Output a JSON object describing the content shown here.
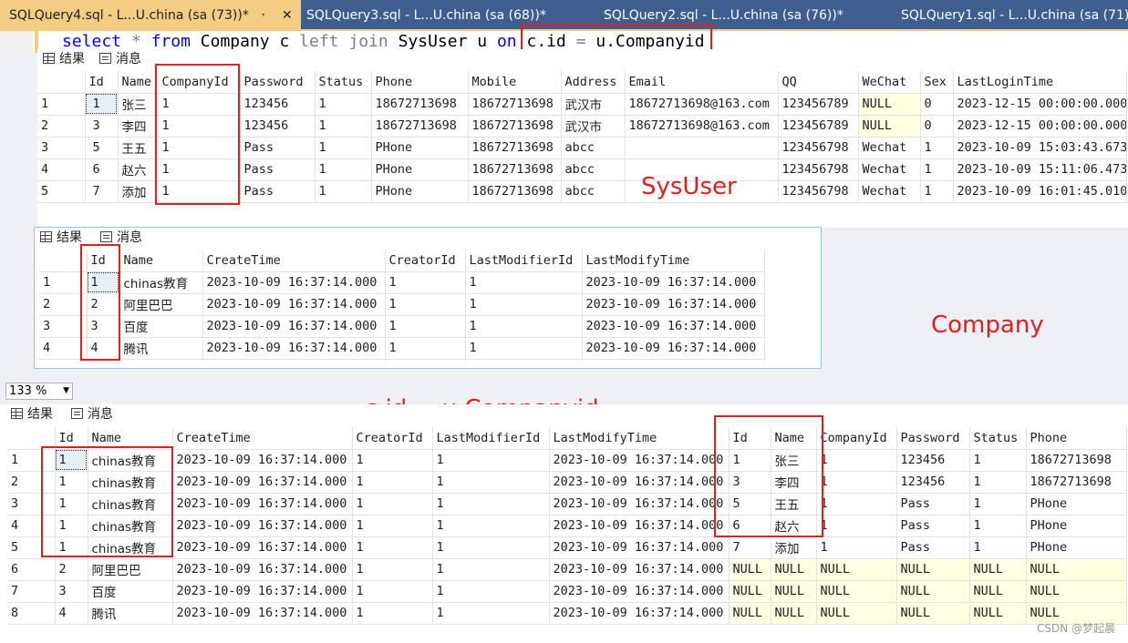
{
  "tabs": [
    {
      "label": "SQLQuery4.sql - L...U.china (sa (73))*",
      "active": true
    },
    {
      "label": "SQLQuery3.sql - L...U.china (sa (68))*",
      "active": false
    },
    {
      "label": "SQLQuery2.sql - L...U.china (sa (76))*",
      "active": false
    },
    {
      "label": "SQLQuery1.sql - L...U.china (sa (71))",
      "active": false
    }
  ],
  "editor": {
    "kw_select": "select",
    "star": "*",
    "kw_from": "from",
    "table1": "Company",
    "alias1": "c",
    "kw_left": "left",
    "kw_join": "join",
    "table2": "SysUser",
    "alias2": "u",
    "kw_on": "on",
    "lhs": "c.id",
    "eq": "=",
    "rhs": "u.Companyid"
  },
  "result_tab_label": "结果",
  "messages_tab_label": "消息",
  "zoom": "133 %",
  "annotations": {
    "sysuser": "SysUser",
    "company": "Company",
    "join_cond": "c.id = u.Companyid"
  },
  "watermark": "CSDN @梦起晨",
  "grid1": {
    "columns": [
      "",
      "Id",
      "Name",
      "CompanyId",
      "Password",
      "Status",
      "Phone",
      "Mobile",
      "Address",
      "Email",
      "QQ",
      "WeChat",
      "Sex",
      "LastLoginTime"
    ],
    "rows": [
      [
        "1",
        "1",
        "张三",
        "1",
        "123456",
        "1",
        "18672713698",
        "18672713698",
        "武汉市",
        "18672713698@163.com",
        "123456789",
        "NULL",
        "0",
        "2023-12-15 00:00:00.000"
      ],
      [
        "2",
        "3",
        "李四",
        "1",
        "123456",
        "1",
        "18672713698",
        "18672713698",
        "武汉市",
        "18672713698@163.com",
        "123456789",
        "NULL",
        "0",
        "2023-12-15 00:00:00.000"
      ],
      [
        "3",
        "5",
        "王五",
        "1",
        "Pass",
        "1",
        "PHone",
        "18672713698",
        "abcc",
        "",
        "123456798",
        "Wechat",
        "1",
        "2023-10-09 15:03:43.673"
      ],
      [
        "4",
        "6",
        "赵六",
        "1",
        "Pass",
        "1",
        "PHone",
        "18672713698",
        "abcc",
        "",
        "123456798",
        "Wechat",
        "1",
        "2023-10-09 15:11:06.473"
      ],
      [
        "5",
        "7",
        "添加",
        "1",
        "Pass",
        "1",
        "PHone",
        "18672713698",
        "abcc",
        "",
        "123456798",
        "Wechat",
        "1",
        "2023-10-09 16:01:45.010"
      ]
    ]
  },
  "grid2": {
    "columns": [
      "",
      "Id",
      "Name",
      "CreateTime",
      "CreatorId",
      "LastModifierId",
      "LastModifyTime"
    ],
    "rows": [
      [
        "1",
        "1",
        "chinas教育",
        "2023-10-09 16:37:14.000",
        "1",
        "1",
        "2023-10-09 16:37:14.000"
      ],
      [
        "2",
        "2",
        "阿里巴巴",
        "2023-10-09 16:37:14.000",
        "1",
        "1",
        "2023-10-09 16:37:14.000"
      ],
      [
        "3",
        "3",
        "百度",
        "2023-10-09 16:37:14.000",
        "1",
        "1",
        "2023-10-09 16:37:14.000"
      ],
      [
        "4",
        "4",
        "腾讯",
        "2023-10-09 16:37:14.000",
        "1",
        "1",
        "2023-10-09 16:37:14.000"
      ]
    ]
  },
  "grid3": {
    "columns": [
      "",
      "Id",
      "Name",
      "CreateTime",
      "CreatorId",
      "LastModifierId",
      "LastModifyTime",
      "Id",
      "Name",
      "CompanyId",
      "Password",
      "Status",
      "Phone"
    ],
    "rows": [
      [
        "1",
        "1",
        "chinas教育",
        "2023-10-09 16:37:14.000",
        "1",
        "1",
        "2023-10-09 16:37:14.000",
        "1",
        "张三",
        "1",
        "123456",
        "1",
        "18672713698"
      ],
      [
        "2",
        "1",
        "chinas教育",
        "2023-10-09 16:37:14.000",
        "1",
        "1",
        "2023-10-09 16:37:14.000",
        "3",
        "李四",
        "1",
        "123456",
        "1",
        "18672713698"
      ],
      [
        "3",
        "1",
        "chinas教育",
        "2023-10-09 16:37:14.000",
        "1",
        "1",
        "2023-10-09 16:37:14.000",
        "5",
        "王五",
        "1",
        "Pass",
        "1",
        "PHone"
      ],
      [
        "4",
        "1",
        "chinas教育",
        "2023-10-09 16:37:14.000",
        "1",
        "1",
        "2023-10-09 16:37:14.000",
        "6",
        "赵六",
        "1",
        "Pass",
        "1",
        "PHone"
      ],
      [
        "5",
        "1",
        "chinas教育",
        "2023-10-09 16:37:14.000",
        "1",
        "1",
        "2023-10-09 16:37:14.000",
        "7",
        "添加",
        "1",
        "Pass",
        "1",
        "PHone"
      ],
      [
        "6",
        "2",
        "阿里巴巴",
        "2023-10-09 16:37:14.000",
        "1",
        "1",
        "2023-10-09 16:37:14.000",
        "NULL",
        "NULL",
        "NULL",
        "NULL",
        "NULL",
        "NULL"
      ],
      [
        "7",
        "3",
        "百度",
        "2023-10-09 16:37:14.000",
        "1",
        "1",
        "2023-10-09 16:37:14.000",
        "NULL",
        "NULL",
        "NULL",
        "NULL",
        "NULL",
        "NULL"
      ],
      [
        "8",
        "4",
        "腾讯",
        "2023-10-09 16:37:14.000",
        "1",
        "1",
        "2023-10-09 16:37:14.000",
        "NULL",
        "NULL",
        "NULL",
        "NULL",
        "NULL",
        "NULL"
      ]
    ]
  }
}
